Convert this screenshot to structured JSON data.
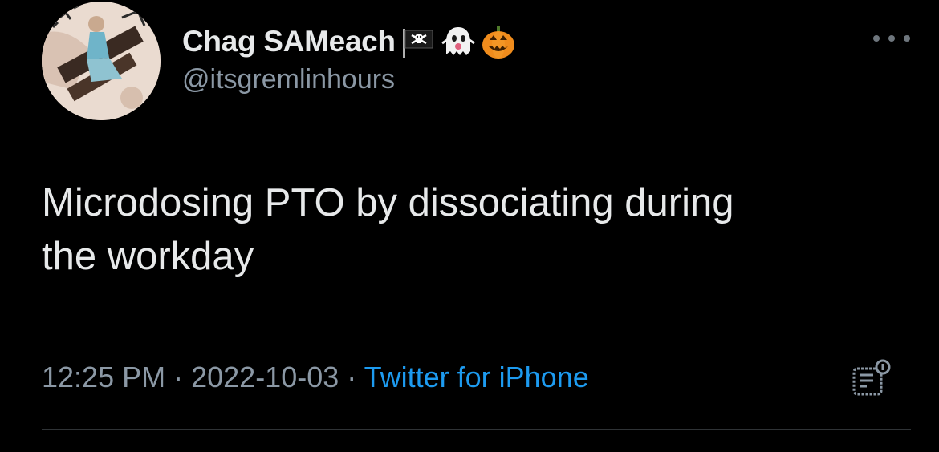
{
  "tweet": {
    "display_name": "Chag SAMeach",
    "name_emojis": [
      "pirate-flag-emoji",
      "ghost-emoji",
      "jack-o-lantern-emoji"
    ],
    "handle": "@itsgremlinhours",
    "text_line1": "Microdosing PTO by dissociating during",
    "text_line2": "the workday",
    "time": "12:25 PM",
    "separator": "·",
    "date": "2022-10-03",
    "source": "Twitter for iPhone"
  },
  "colors": {
    "background": "#000000",
    "primary_text": "#e7e9ea",
    "secondary_text": "#8b98a5",
    "link": "#1d9bf0",
    "divider": "#2f3336"
  },
  "icons": {
    "more": "more-icon",
    "analytics": "analytics-icon"
  }
}
